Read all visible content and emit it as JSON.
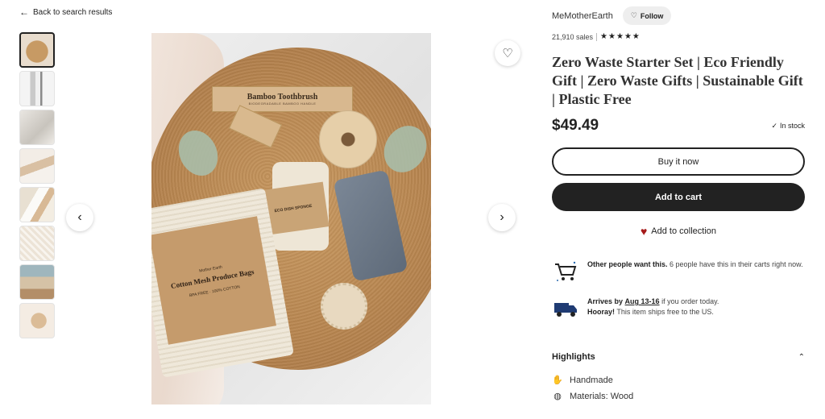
{
  "nav": {
    "back_label": "Back to search results"
  },
  "gallery": {
    "thumbnails": [
      "thumb-1",
      "thumb-2",
      "thumb-3",
      "thumb-4",
      "thumb-5",
      "thumb-6",
      "thumb-7",
      "thumb-8"
    ],
    "active_index": 0,
    "photo_text": {
      "toothbrush_title": "Bamboo Toothbrush",
      "toothbrush_sub": "BIODEGRADABLE BAMBOO HANDLE",
      "sponge_title": "ECO DISH SPONGE",
      "bag_brand": "Mother Earth",
      "bag_title": "Cotton Mesh Produce Bags",
      "bag_icons": "BPA FREE · 100% COTTON"
    }
  },
  "shop": {
    "name": "MeMotherEarth",
    "follow_label": "Follow",
    "sales": "21,910 sales",
    "rating_stars": 5
  },
  "product": {
    "title": "Zero Waste Starter Set | Eco Friendly Gift | Zero Waste Gifts | Sustainable Gift | Plastic Free",
    "price": "$49.49",
    "stock": "In stock",
    "buy_now_label": "Buy it now",
    "add_to_cart_label": "Add to cart",
    "add_to_collection_label": "Add to collection"
  },
  "info": {
    "demand_bold": "Other people want this.",
    "demand_text": " 6 people have this in their carts right now.",
    "arrives_bold": "Arrives by",
    "arrives_date": "Aug 13-16",
    "arrives_text": " if you order today.",
    "shipping_bold": "Hooray!",
    "shipping_text": " This item ships free to the US."
  },
  "highlights": {
    "title": "Highlights",
    "items": [
      {
        "icon": "hand-icon",
        "label": "Handmade"
      },
      {
        "icon": "materials-icon",
        "label": "Materials: Wood"
      }
    ]
  },
  "colors": {
    "accent_dark": "#222222",
    "heart_red": "#a61a1a"
  }
}
